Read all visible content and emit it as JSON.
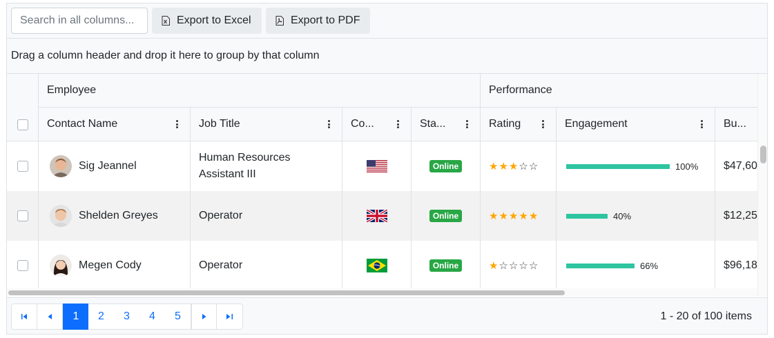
{
  "toolbar": {
    "search_placeholder": "Search in all columns...",
    "export_excel_label": "Export to Excel",
    "export_pdf_label": "Export to PDF"
  },
  "group_panel": {
    "hint": "Drag a column header and drop it here to group by that column"
  },
  "column_groups": {
    "employee": "Employee",
    "performance": "Performance"
  },
  "columns": {
    "contact_name": "Contact Name",
    "job_title": "Job Title",
    "country": "Co...",
    "status": "Sta...",
    "rating": "Rating",
    "engagement": "Engagement",
    "budget": "Bu..."
  },
  "rows": [
    {
      "name": "Sig Jeannel",
      "job": "Human Resources Assistant III",
      "country_flag": "us-flag",
      "status": "Online",
      "rating": 3,
      "rating_max": 5,
      "engagement": "100%",
      "engagement_value": 1.0,
      "budget": "$47,60"
    },
    {
      "name": "Shelden Greyes",
      "job": "Operator",
      "country_flag": "uk-flag",
      "status": "Online",
      "rating": 5,
      "rating_max": 5,
      "engagement": "40%",
      "engagement_value": 0.4,
      "budget": "$12,25"
    },
    {
      "name": "Megen Cody",
      "job": "Operator",
      "country_flag": "brazil-flag",
      "status": "Online",
      "rating": 1,
      "rating_max": 5,
      "engagement": "66%",
      "engagement_value": 0.66,
      "budget": "$96,18"
    }
  ],
  "pager": {
    "pages": [
      "1",
      "2",
      "3",
      "4",
      "5"
    ],
    "current_page": "1",
    "info": "1 - 20 of 100 items"
  },
  "colors": {
    "accent": "#0d6efd",
    "online": "#28a745",
    "bar": "#2ec4a0",
    "star": "#ffa500"
  }
}
